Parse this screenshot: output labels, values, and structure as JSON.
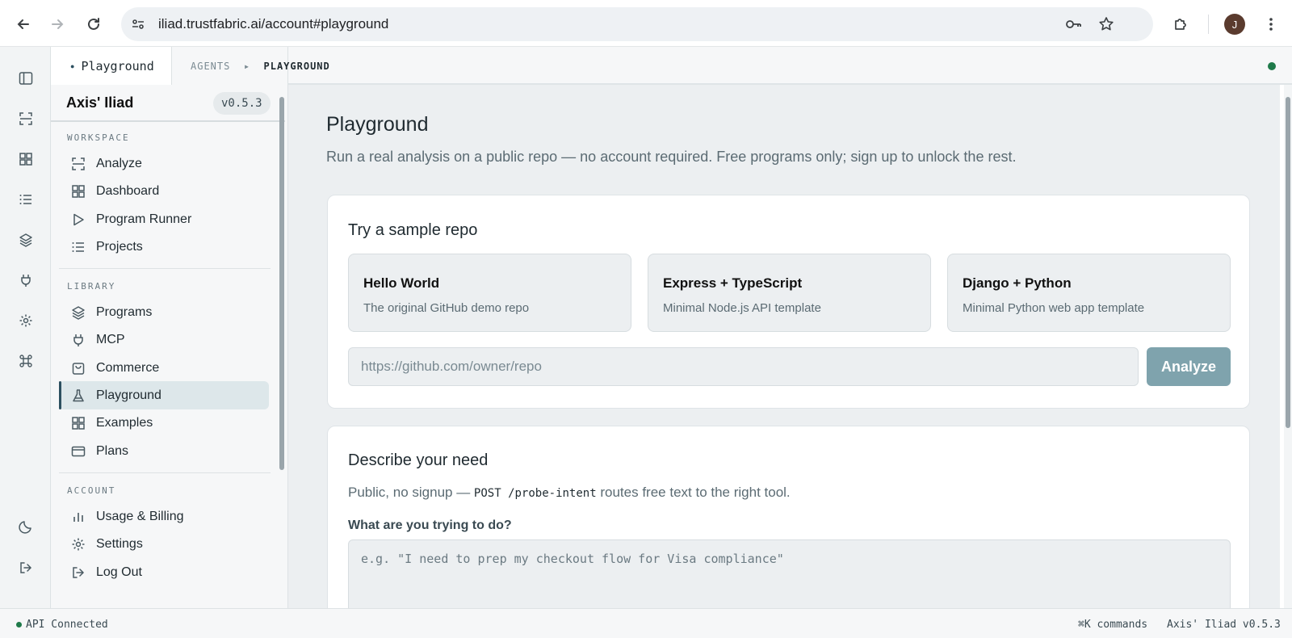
{
  "browser": {
    "url": "iliad.trustfabric.ai/account#playground",
    "avatar_letter": "J"
  },
  "sidebar": {
    "tab_label": "Playground",
    "brand": "Axis' Iliad",
    "version": "v0.5.3",
    "sections": [
      {
        "label": "WORKSPACE",
        "items": [
          {
            "label": "Analyze",
            "icon": "scan-icon"
          },
          {
            "label": "Dashboard",
            "icon": "grid-icon"
          },
          {
            "label": "Program Runner",
            "icon": "play-icon"
          },
          {
            "label": "Projects",
            "icon": "list-icon"
          }
        ]
      },
      {
        "label": "LIBRARY",
        "items": [
          {
            "label": "Programs",
            "icon": "layers-icon"
          },
          {
            "label": "MCP",
            "icon": "plug-icon"
          },
          {
            "label": "Commerce",
            "icon": "bag-icon"
          },
          {
            "label": "Playground",
            "icon": "flask-icon",
            "active": true
          },
          {
            "label": "Examples",
            "icon": "grid-icon"
          },
          {
            "label": "Plans",
            "icon": "card-icon"
          }
        ]
      },
      {
        "label": "ACCOUNT",
        "items": [
          {
            "label": "Usage & Billing",
            "icon": "bar-chart-icon"
          },
          {
            "label": "Settings",
            "icon": "gear-icon"
          },
          {
            "label": "Log Out",
            "icon": "logout-icon"
          }
        ]
      }
    ]
  },
  "breadcrumb": {
    "parent": "AGENTS",
    "separator": "▸",
    "current": "PLAYGROUND"
  },
  "main": {
    "title": "Playground",
    "subtitle": "Run a real analysis on a public repo — no account required. Free programs only; sign up to unlock the rest.",
    "sample_card": {
      "title": "Try a sample repo",
      "repos": [
        {
          "name": "Hello World",
          "desc": "The original GitHub demo repo"
        },
        {
          "name": "Express + TypeScript",
          "desc": "Minimal Node.js API template"
        },
        {
          "name": "Django + Python",
          "desc": "Minimal Python web app template"
        }
      ],
      "url_placeholder": "https://github.com/owner/repo",
      "analyze_label": "Analyze"
    },
    "describe_card": {
      "title": "Describe your need",
      "sub_prefix": "Public, no signup — ",
      "sub_code": "POST /probe-intent",
      "sub_suffix": " routes free text to the right tool.",
      "field_label": "What are you trying to do?",
      "placeholder": "e.g. \"I need to prep my checkout flow for Visa compliance\""
    }
  },
  "statusbar": {
    "connection": "API Connected",
    "shortcut": "⌘K commands",
    "app_version": "Axis' Iliad v0.5.3"
  },
  "colors": {
    "accent": "#2c5060",
    "status_green": "#1f7a4a",
    "analyze_button": "#7fa3ad"
  }
}
